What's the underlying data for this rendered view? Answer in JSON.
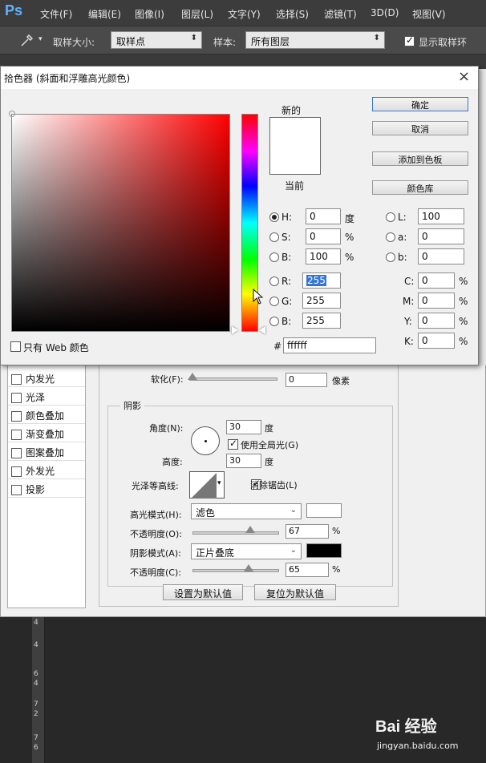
{
  "menubar": {
    "logo": "Ps",
    "items": [
      "文件(F)",
      "编辑(E)",
      "图像(I)",
      "图层(L)",
      "文字(Y)",
      "选择(S)",
      "滤镜(T)",
      "3D(D)",
      "视图(V)"
    ]
  },
  "options_bar": {
    "sample_size_label": "取样大小:",
    "sample_size_value": "取样点",
    "sample_label": "样本:",
    "sample_value": "所有图层",
    "show_ring_label": "显示取样环"
  },
  "layer_style": {
    "styles": [
      {
        "label": "内发光",
        "checked": false
      },
      {
        "label": "光泽",
        "checked": false
      },
      {
        "label": "颜色叠加",
        "checked": false
      },
      {
        "label": "渐变叠加",
        "checked": false
      },
      {
        "label": "图案叠加",
        "checked": false
      },
      {
        "label": "外发光",
        "checked": false
      },
      {
        "label": "投影",
        "checked": false
      }
    ],
    "soften_label": "软化(F):",
    "soften_value": "0",
    "soften_unit": "像素",
    "shading_title": "阴影",
    "angle_label": "角度(N):",
    "angle_value": "30",
    "angle_unit": "度",
    "global_light_label": "使用全局光(G)",
    "altitude_label": "高度:",
    "altitude_value": "30",
    "altitude_unit": "度",
    "gloss_contour_label": "光泽等高线:",
    "antialias_label": "消除锯齿(L)",
    "highlight_mode_label": "高光模式(H):",
    "highlight_mode_value": "滤色",
    "highlight_opacity_label": "不透明度(O):",
    "highlight_opacity_value": "67",
    "shadow_mode_label": "阴影模式(A):",
    "shadow_mode_value": "正片叠底",
    "shadow_opacity_label": "不透明度(C):",
    "shadow_opacity_value": "65",
    "percent": "%",
    "make_default_label": "设置为默认值",
    "reset_default_label": "复位为默认值",
    "colors": {
      "highlight": "#ffffff",
      "shadow": "#000000"
    }
  },
  "color_picker": {
    "title": "拾色器 (斜面和浮雕高光颜色)",
    "close": "×",
    "new_label": "新的",
    "current_label": "当前",
    "ok_label": "确定",
    "cancel_label": "取消",
    "add_swatch_label": "添加到色板",
    "color_libraries_label": "颜色库",
    "web_only_label": "只有 Web 颜色",
    "hsb": {
      "h_label": "H:",
      "h_value": "0",
      "h_unit": "度",
      "s_label": "S:",
      "s_value": "0",
      "s_unit": "%",
      "b_label": "B:",
      "b_value": "100",
      "b_unit": "%"
    },
    "rgb": {
      "r_label": "R:",
      "r_value": "255",
      "g_label": "G:",
      "g_value": "255",
      "b_label": "B:",
      "b_value": "255"
    },
    "lab": {
      "l_label": "L:",
      "l_value": "100",
      "a_label": "a:",
      "a_value": "0",
      "b_label": "b:",
      "b_value": "0"
    },
    "cmyk": {
      "c_label": "C:",
      "c_value": "0",
      "m_label": "M:",
      "m_value": "0",
      "y_label": "Y:",
      "y_value": "0",
      "k_label": "K:",
      "k_value": "0",
      "unit": "%"
    },
    "hex_label": "#",
    "hex_value": "ffffff",
    "selected_mode": "H",
    "hue_color": "#ff0000",
    "new_color": "#ffffff",
    "current_color": "#ffffff"
  },
  "ruler_ticks": [
    "4",
    "4",
    "6",
    "4",
    "7",
    "2",
    "7",
    "6"
  ],
  "watermark": {
    "main": "Bai 经验",
    "sub": "jingyan.baidu.com"
  }
}
